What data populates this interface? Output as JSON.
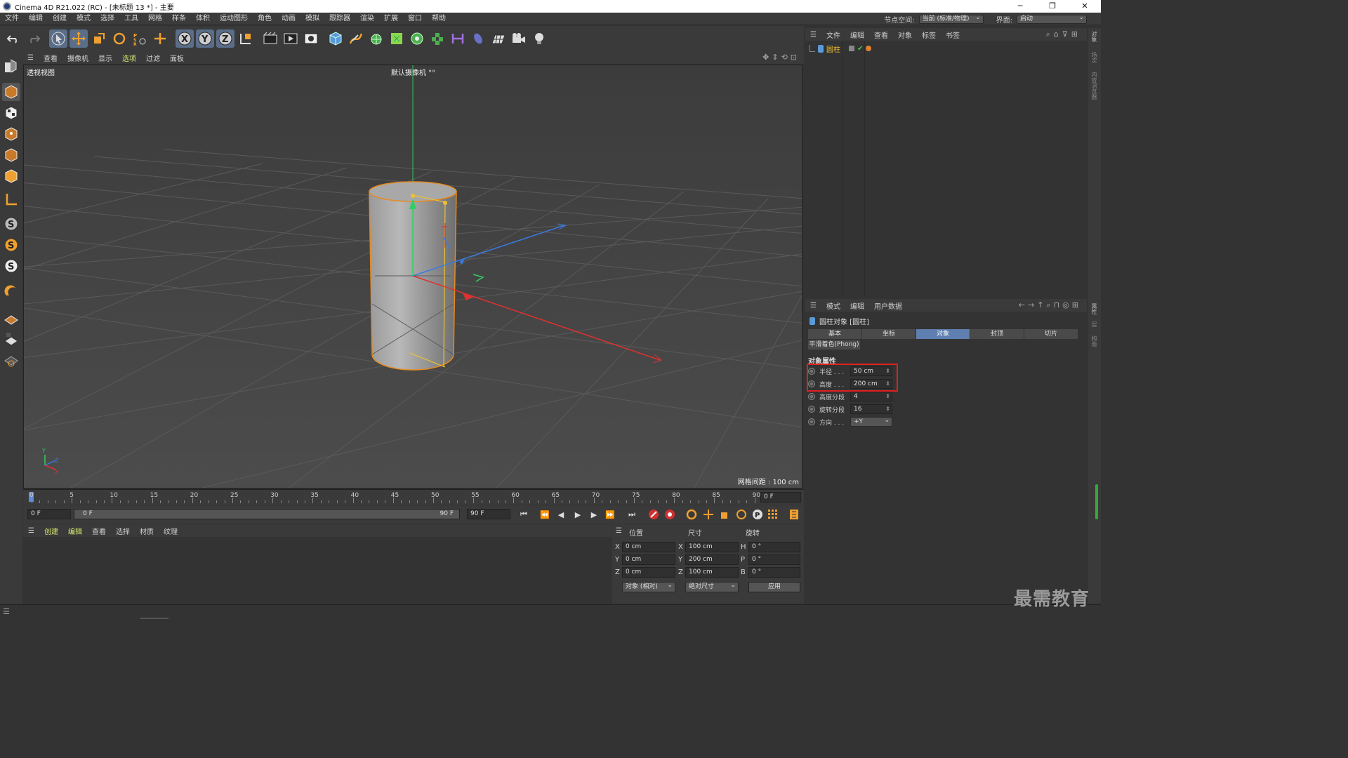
{
  "window": {
    "title": "Cinema 4D R21.022 (RC) - [未标题 13 *] - 主要",
    "min": "─",
    "max": "❐",
    "close": "✕"
  },
  "menu": [
    "文件",
    "编辑",
    "创建",
    "模式",
    "选择",
    "工具",
    "网格",
    "样条",
    "体积",
    "运动图形",
    "角色",
    "动画",
    "模拟",
    "跟踪器",
    "渲染",
    "扩展",
    "窗口",
    "帮助"
  ],
  "menu_right": {
    "node_label": "节点空间:",
    "node_value": "当前 (标准/物理)",
    "ui_label": "界面:",
    "ui_value": "启动"
  },
  "viewport": {
    "menu": [
      "查看",
      "摄像机",
      "显示",
      "选项",
      "过滤",
      "面板"
    ],
    "label": "透视视图",
    "camera": "默认摄像机 °°",
    "grid_info": "网格间距 : 100 cm"
  },
  "timeline": {
    "ticks": [
      "0",
      "5",
      "10",
      "15",
      "20",
      "25",
      "30",
      "35",
      "40",
      "45",
      "50",
      "55",
      "60",
      "65",
      "70",
      "75",
      "80",
      "85",
      "90"
    ],
    "current": "0 F"
  },
  "transport": {
    "start": "0 F",
    "range_start": "0 F",
    "range_end": "90 F",
    "end": "90 F"
  },
  "material": {
    "menu": [
      "创建",
      "编辑",
      "查看",
      "选择",
      "材质",
      "纹理"
    ]
  },
  "coords": {
    "headers": [
      "位置",
      "尺寸",
      "旋转"
    ],
    "rows": [
      {
        "a": "X",
        "pos": "0 cm",
        "b": "X",
        "size": "100 cm",
        "c": "H",
        "rot": "0 °"
      },
      {
        "a": "Y",
        "pos": "0 cm",
        "b": "Y",
        "size": "200 cm",
        "c": "P",
        "rot": "0 °"
      },
      {
        "a": "Z",
        "pos": "0 cm",
        "b": "Z",
        "size": "100 cm",
        "c": "B",
        "rot": "0 °"
      }
    ],
    "mode": "对象 (相对)",
    "size_mode": "绝对尺寸",
    "apply": "应用"
  },
  "objmgr": {
    "menu": [
      "文件",
      "编辑",
      "查看",
      "对象",
      "标签",
      "书签"
    ],
    "object": "圆柱"
  },
  "attr": {
    "menu": [
      "模式",
      "编辑",
      "用户数据"
    ],
    "title": "圆柱对象 [圆柱]",
    "tabs": [
      "基本",
      "坐标",
      "对象",
      "封顶",
      "切片"
    ],
    "phong": "平滑着色(Phong)",
    "section": "对象属性",
    "props": [
      {
        "label": "半径 . . .",
        "value": "50 cm"
      },
      {
        "label": "高度 . . .",
        "value": "200 cm"
      },
      {
        "label": "高度分段",
        "value": "4"
      },
      {
        "label": "旋转分段",
        "value": "16"
      },
      {
        "label": "方向 . . .",
        "value": "+Y"
      }
    ]
  },
  "right_tabs": [
    "对象",
    "场次",
    "内容浏览器",
    "属性",
    "层",
    "构造"
  ],
  "watermark": "最需教育",
  "colors": {
    "accent": "#5e7fb0",
    "highlight": "#e02020",
    "selection": "#f0a030"
  }
}
